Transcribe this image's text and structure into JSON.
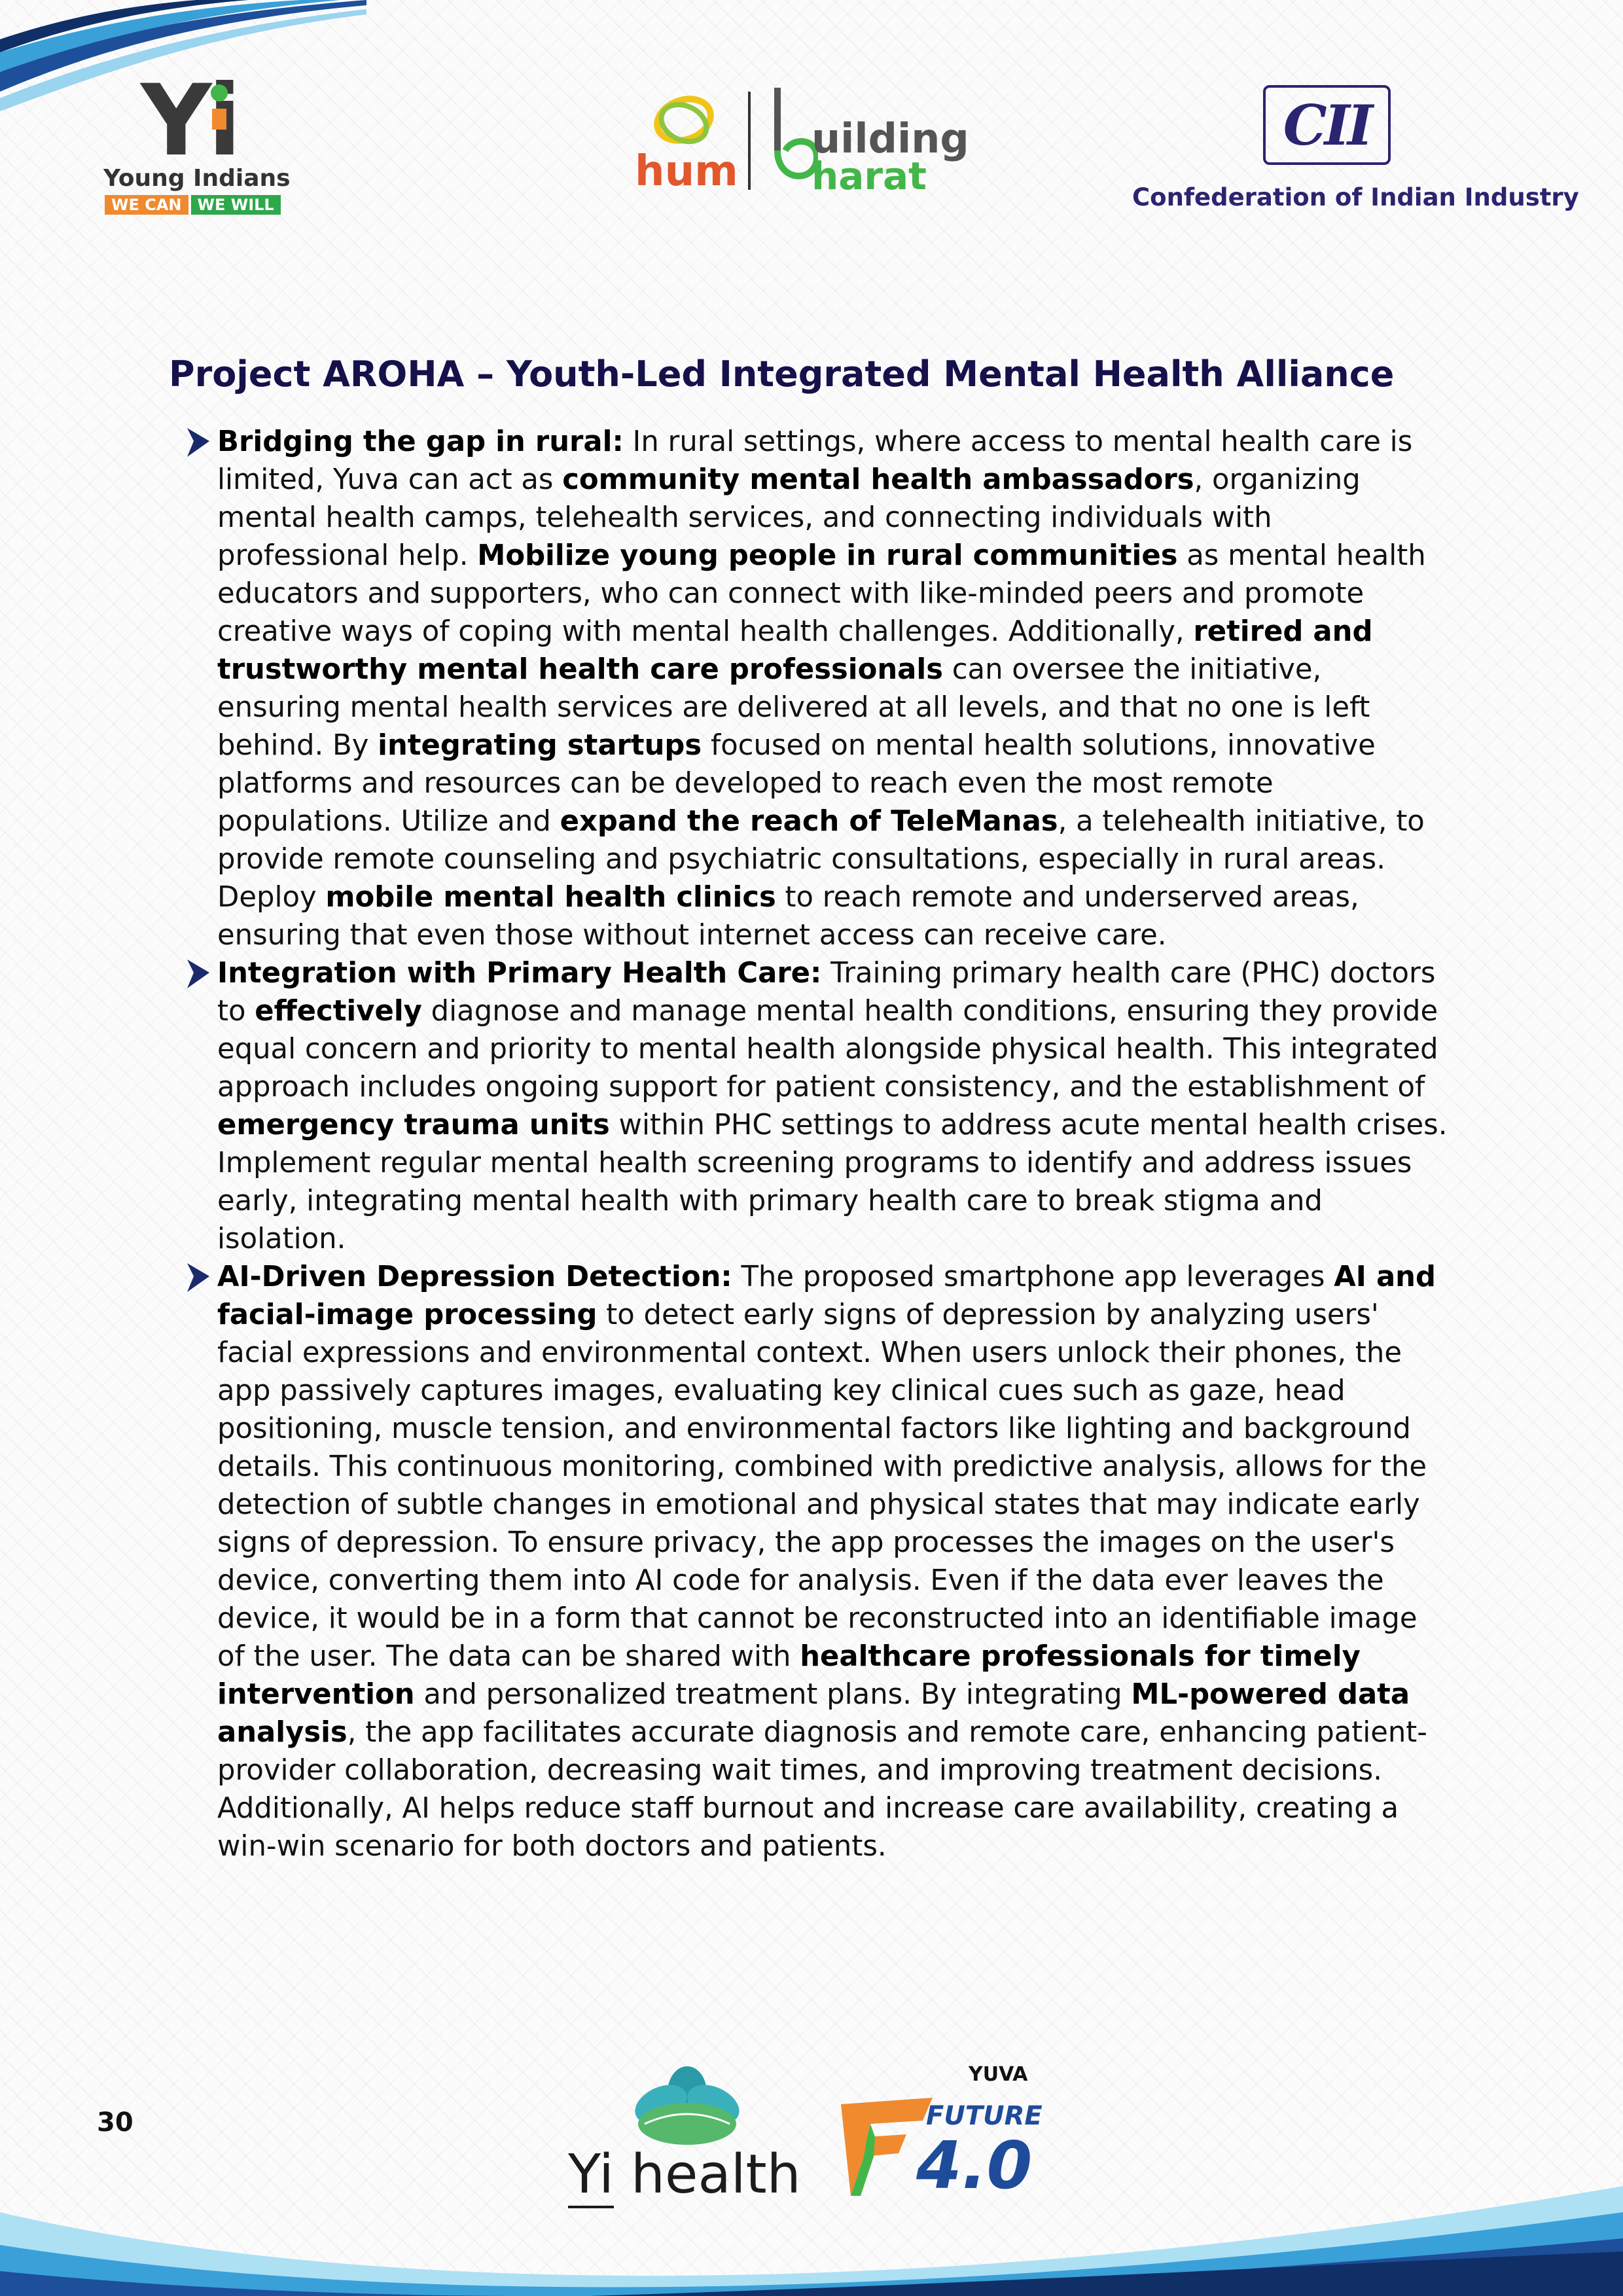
{
  "header": {
    "yi_logo": {
      "mark": "Yi",
      "name": "Young Indians",
      "tag_left": "WE CAN",
      "tag_right": "WE WILL"
    },
    "hum_logo": {
      "hum": "hum",
      "building": "uilding",
      "bharat": "harat"
    },
    "cii_logo": {
      "mark": "CII",
      "name": "Confederation of Indian Industry"
    }
  },
  "title": "Project AROHA – Youth-Led Integrated Mental Health Alliance",
  "bullets": [
    {
      "segments": [
        {
          "b": "Bridging the gap in rural:"
        },
        {
          "t": " In rural settings, where access to mental health care is limited, Yuva can act as "
        },
        {
          "b": "community mental health ambassadors"
        },
        {
          "t": ", organizing mental health camps, telehealth services, and connecting individuals with professional help. "
        },
        {
          "b": "Mobilize young people in rural communities"
        },
        {
          "t": " as mental health educators and supporters, who can connect with like-minded peers and promote creative ways of coping with mental health challenges. Additionally, "
        },
        {
          "b": "retired and trustworthy mental health care professionals"
        },
        {
          "t": " can oversee the initiative, ensuring mental health services are delivered at all levels, and that no one is left behind. By "
        },
        {
          "b": "integrating startups"
        },
        {
          "t": " focused on mental health solutions, innovative platforms and resources can be developed to reach even the most remote populations. Utilize and "
        },
        {
          "b": "expand the reach of TeleManas"
        },
        {
          "t": ", a telehealth initiative, to provide remote counseling and psychiatric consultations, especially in rural areas. Deploy "
        },
        {
          "b": "mobile mental health clinics"
        },
        {
          "t": " to reach remote and underserved areas, ensuring that even those without internet access can receive care."
        }
      ]
    },
    {
      "segments": [
        {
          "b": "Integration with Primary Health Care:"
        },
        {
          "t": " Training primary health care (PHC) doctors to "
        },
        {
          "b": "effectively"
        },
        {
          "t": " diagnose and manage mental health conditions, ensuring they provide equal concern and priority to mental health alongside physical health. This integrated approach includes ongoing support for patient consistency, and the establishment of "
        },
        {
          "b": "emergency trauma units"
        },
        {
          "t": " within PHC settings to address acute mental health crises. Implement regular mental health screening programs to identify and address issues early, integrating mental health with primary health care to break stigma and isolation."
        }
      ]
    },
    {
      "segments": [
        {
          "b": "AI-Driven Depression Detection:"
        },
        {
          "t": " The proposed smartphone app leverages "
        },
        {
          "b": "AI and facial-image processing"
        },
        {
          "t": " to detect early signs of depression by analyzing users' facial expressions and environmental context. When users unlock their phones, the app passively captures images, evaluating key clinical cues such as gaze, head positioning, muscle tension, and environmental factors like lighting and background details. This continuous monitoring, combined with predictive analysis, allows for the detection of subtle changes in emotional and physical states that may indicate early signs of depression. To ensure privacy, the app processes the images on the user's device, converting them into AI code for analysis. Even if the data ever leaves the device, it would be in a form that cannot be reconstructed into an identifiable image of the user. The data can be shared with "
        },
        {
          "b": "healthcare professionals for timely intervention"
        },
        {
          "t": " and personalized treatment plans. By integrating "
        },
        {
          "b": "ML-powered data analysis"
        },
        {
          "t": ", the app facilitates accurate diagnosis and remote care, enhancing patient-provider collaboration, decreasing wait times, and improving treatment decisions. Additionally, AI helps reduce staff burnout and increase care availability, creating a win-win scenario for both doctors and patients."
        }
      ]
    }
  ],
  "footer": {
    "page_number": "30",
    "yi_health": {
      "yi": "Yi",
      "health": "health"
    },
    "future_logo": {
      "yuva": "YUVA",
      "future": "FUTURE",
      "version": "4.0"
    }
  }
}
